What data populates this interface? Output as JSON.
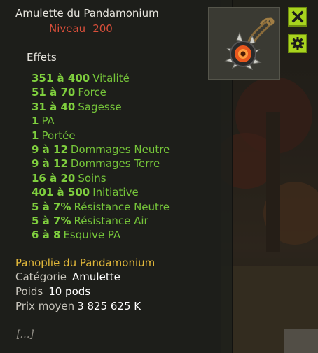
{
  "item": {
    "name": "Amulette du Pandamonium",
    "level_label": "Niveau",
    "level_value": "200"
  },
  "effects_title": "Effets",
  "effects": [
    {
      "value": "351 à 400",
      "name": "Vitalité"
    },
    {
      "value": "51 à 70",
      "name": "Force"
    },
    {
      "value": "31 à 40",
      "name": "Sagesse"
    },
    {
      "value": "1",
      "name": "PA"
    },
    {
      "value": "1",
      "name": "Portée"
    },
    {
      "value": "9 à 12",
      "name": "Dommages Neutre"
    },
    {
      "value": "9 à 12",
      "name": "Dommages Terre"
    },
    {
      "value": "16 à 20",
      "name": "Soins"
    },
    {
      "value": "401 à 500",
      "name": "Initiative"
    },
    {
      "value": "5 à 7%",
      "name": "Résistance Neutre"
    },
    {
      "value": "5 à 7%",
      "name": "Résistance Air"
    },
    {
      "value": "6 à 8",
      "name": "Esquive PA"
    }
  ],
  "panoply": "Panoplie du Pandamonium",
  "details": {
    "category_label": "Catégorie",
    "category_value": "Amulette",
    "weight_label": "Poids",
    "weight_value": "10 pods",
    "price_label": "Prix moyen",
    "price_value": "3 825 625 K"
  },
  "more": "[...]",
  "buttons": {
    "close_icon": "close-icon",
    "settings_icon": "gear-icon"
  },
  "colors": {
    "effect_green": "#7fcf3e",
    "level_red": "#d94f3a",
    "panoply_gold": "#e3b93a",
    "button_green": "#a8d41e"
  }
}
